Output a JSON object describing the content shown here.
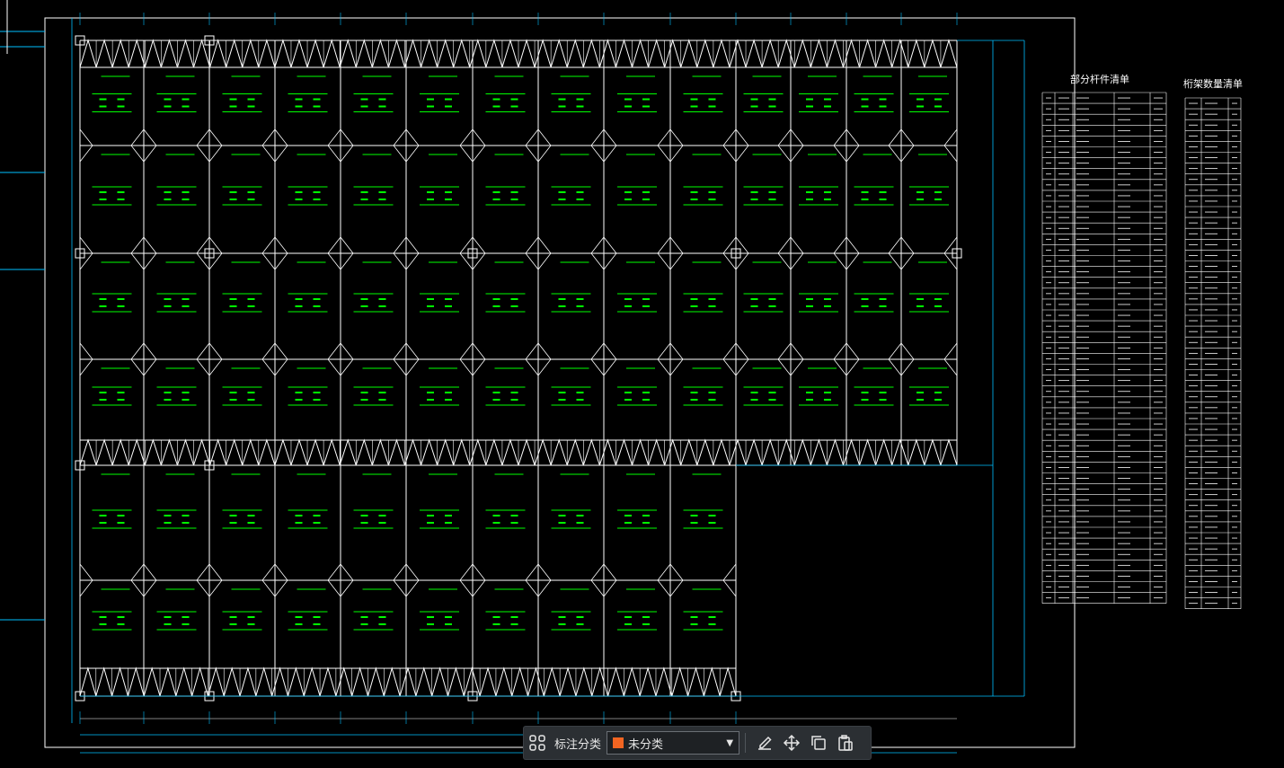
{
  "toolbar": {
    "label": "标注分类",
    "selected_category": "未分类",
    "selected_color": "#f26522",
    "icons": [
      "grid-apps-icon",
      "edit-icon",
      "move-icon",
      "copy-icon",
      "paste-icon"
    ]
  },
  "drawing": {
    "background": "#000000",
    "line_color": "#ffffff",
    "label_color": "#00ff00",
    "dimension_color": "#00bfff",
    "tables": {
      "part_list_title": "部分杆件清单",
      "truss_list_title": "桁架数量清单",
      "part_list_row_count": 46,
      "truss_list_row_count": 46
    }
  }
}
